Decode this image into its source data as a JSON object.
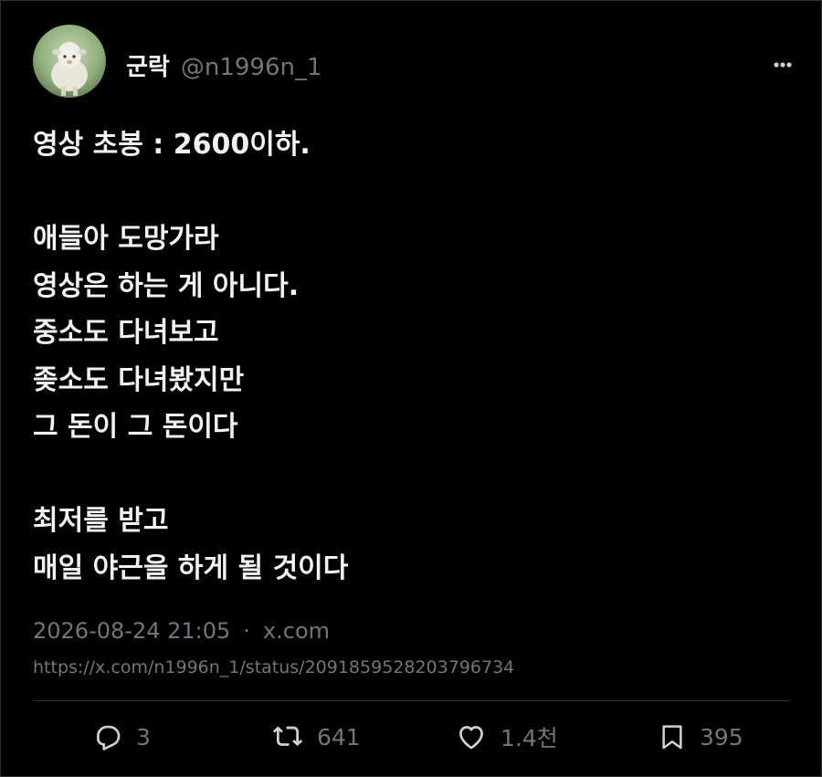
{
  "author": {
    "display_name": "군락",
    "handle": "@n1996n_1",
    "avatar_icon": "sheep-avatar"
  },
  "menu_icon": "more-horizontal-icon",
  "tweet": {
    "lines": [
      "영상 초봉 : 2600이하.",
      "",
      "애들아 도망가라",
      "영상은 하는 게 아니다.",
      "중소도 다녀보고",
      "좆소도 다녀봤지만",
      "그 돈이 그 돈이다",
      "",
      "최저를 받고",
      "매일 야근을 하게 될 것이다"
    ],
    "timestamp": "2026-08-24 21:05",
    "separator": "·",
    "source": "x.com",
    "url": "https://x.com/n1996n_1/status/2091859528203796734"
  },
  "actions": {
    "reply": {
      "icon": "reply-icon",
      "count": "3"
    },
    "retweet": {
      "icon": "retweet-icon",
      "count": "641"
    },
    "like": {
      "icon": "heart-icon",
      "count": "1.4천"
    },
    "bookmark": {
      "icon": "bookmark-icon",
      "count": "395"
    }
  },
  "colors": {
    "background": "#000000",
    "text": "#f2f2f2",
    "muted": "#71767b",
    "border": "#2f3336"
  }
}
